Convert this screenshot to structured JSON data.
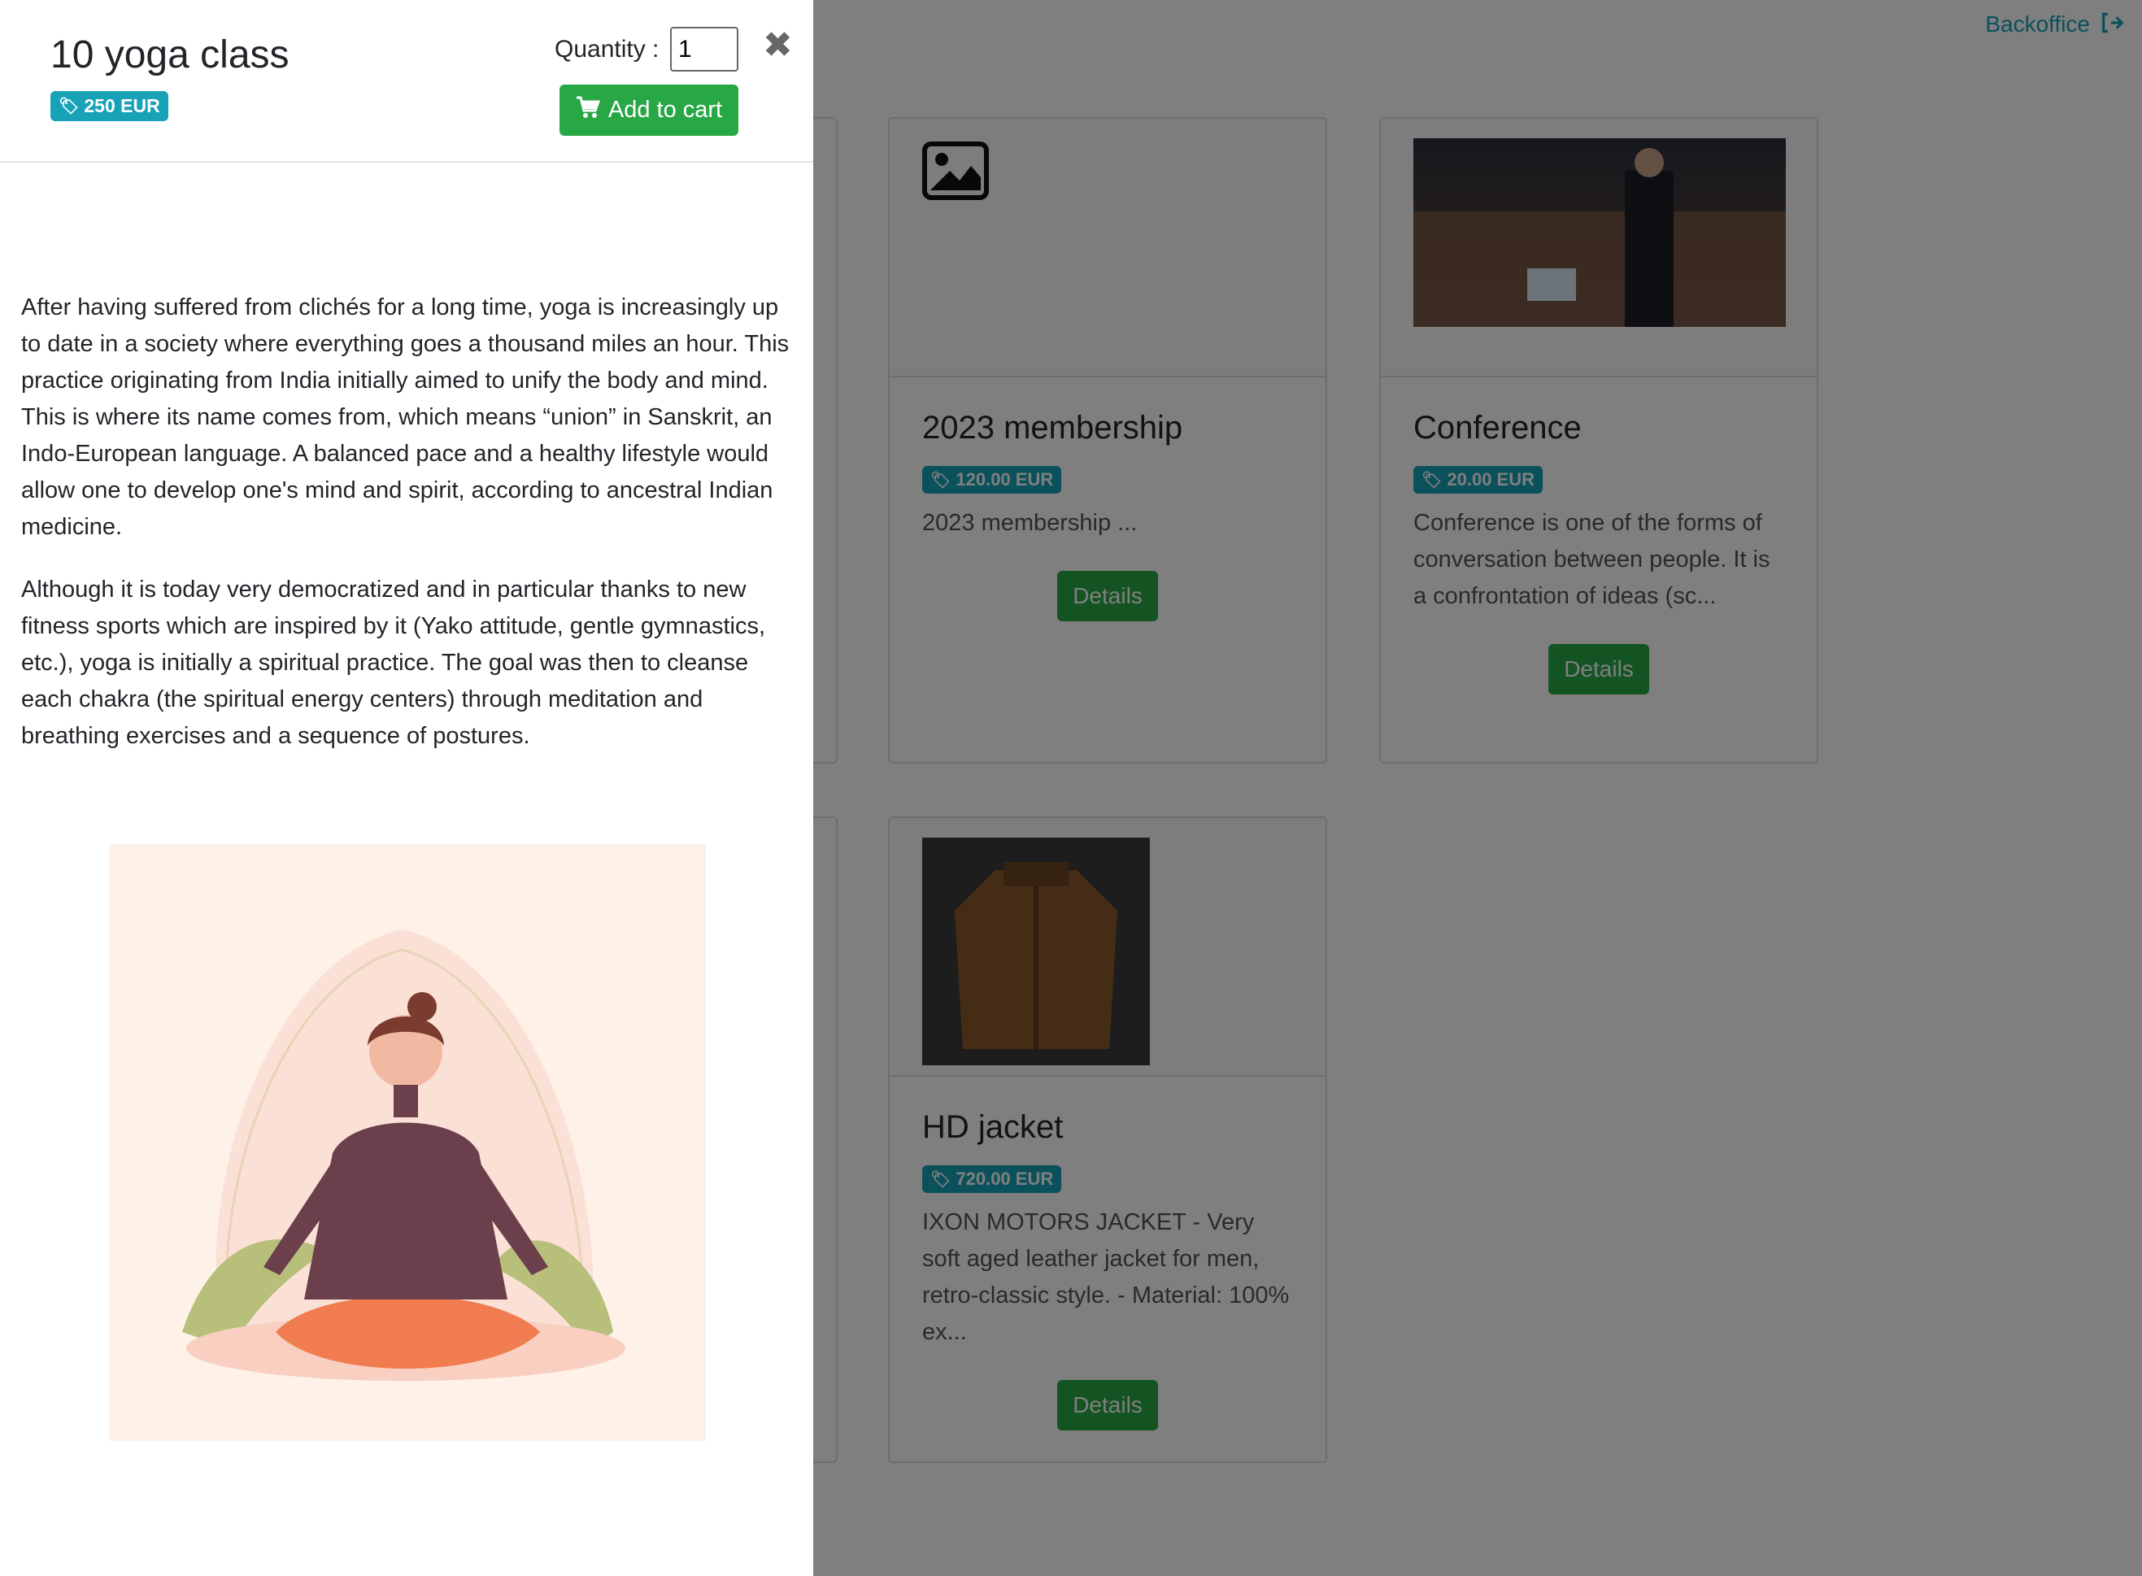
{
  "nav": {
    "backoffice_label": "Backoffice",
    "backoffice_icon": "sign-out-icon"
  },
  "products": [
    {
      "title": "2023 membership",
      "price": "120.00 EUR",
      "description": "2023 membership ...",
      "details_label": "Details",
      "image": "image-placeholder-icon"
    },
    {
      "title": "Conference",
      "price": "20.00 EUR",
      "description": "Conference is one of the forms of conversation between people. It is a confrontation of ideas (sc...",
      "details_label": "Details",
      "image": "conference-photo"
    },
    {
      "title": "HD jacket",
      "price": "720.00 EUR",
      "description": "IXON MOTORS JACKET - Very soft aged leather jacket for men, retro-classic style. - Material: 100% ex...",
      "details_label": "Details",
      "image": "leather-jacket-photo"
    }
  ],
  "modal": {
    "title": "10 yoga class",
    "price": "250 EUR",
    "quantity_label": "Quantity :",
    "quantity_value": "1",
    "add_to_cart_label": "Add to cart",
    "description": [
      "After having suffered from clichés for a long time, yoga is increasingly up to date in a society where everything goes a thousand miles an hour. This practice originating from India initially aimed to unify the body and mind. This is where its name comes from, which means “union” in Sanskrit, an Indo-European language. A balanced pace and a healthy lifestyle would allow one to develop one's mind and spirit, according to ancestral Indian medicine.",
      "Although it is today very democratized and in particular thanks to new fitness sports which are inspired by it (Yako attitude, gentle gymnastics, etc.), yoga is initially a spiritual practice. The goal was then to cleanse each chakra (the spiritual energy centers) through meditation and breathing exercises and a sequence of postures."
    ],
    "image": "yoga-meditation-illustration"
  },
  "colors": {
    "accent": "#17a2b8",
    "button": "#28a745",
    "overlay": "rgba(0,0,0,0.5)"
  }
}
